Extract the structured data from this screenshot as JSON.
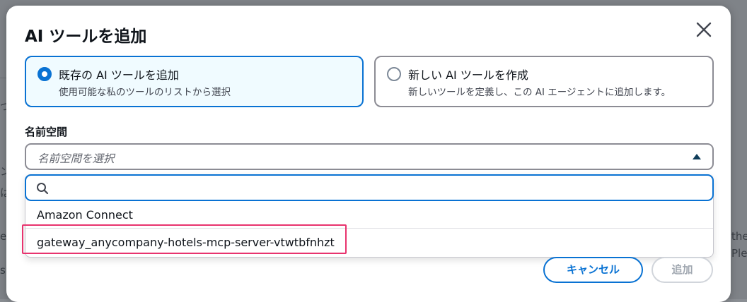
{
  "backdrop": {
    "fragments": [
      "つ",
      "ン",
      "は",
      "e",
      "the",
      "Ple",
      "s"
    ]
  },
  "dialog": {
    "title": "AI ツールを追加",
    "close_icon": "close-icon"
  },
  "tool_type": {
    "options": [
      {
        "title": "既存の AI ツールを追加",
        "description": "使用可能な私のツールのリストから選択",
        "selected": true
      },
      {
        "title": "新しい AI ツールを作成",
        "description": "新しいツールを定義し、この AI エージェントに追加します。",
        "selected": false
      }
    ]
  },
  "namespace": {
    "label": "名前空間",
    "placeholder": "名前空間を選択",
    "filter_value": "",
    "options": [
      "Amazon Connect",
      "gateway_anycompany-hotels-mcp-server-vtwtbfnhzt"
    ]
  },
  "footer": {
    "cancel_label": "キャンセル",
    "add_label": "追加"
  },
  "colors": {
    "accent": "#0972d3",
    "highlight": "#e8336e"
  }
}
